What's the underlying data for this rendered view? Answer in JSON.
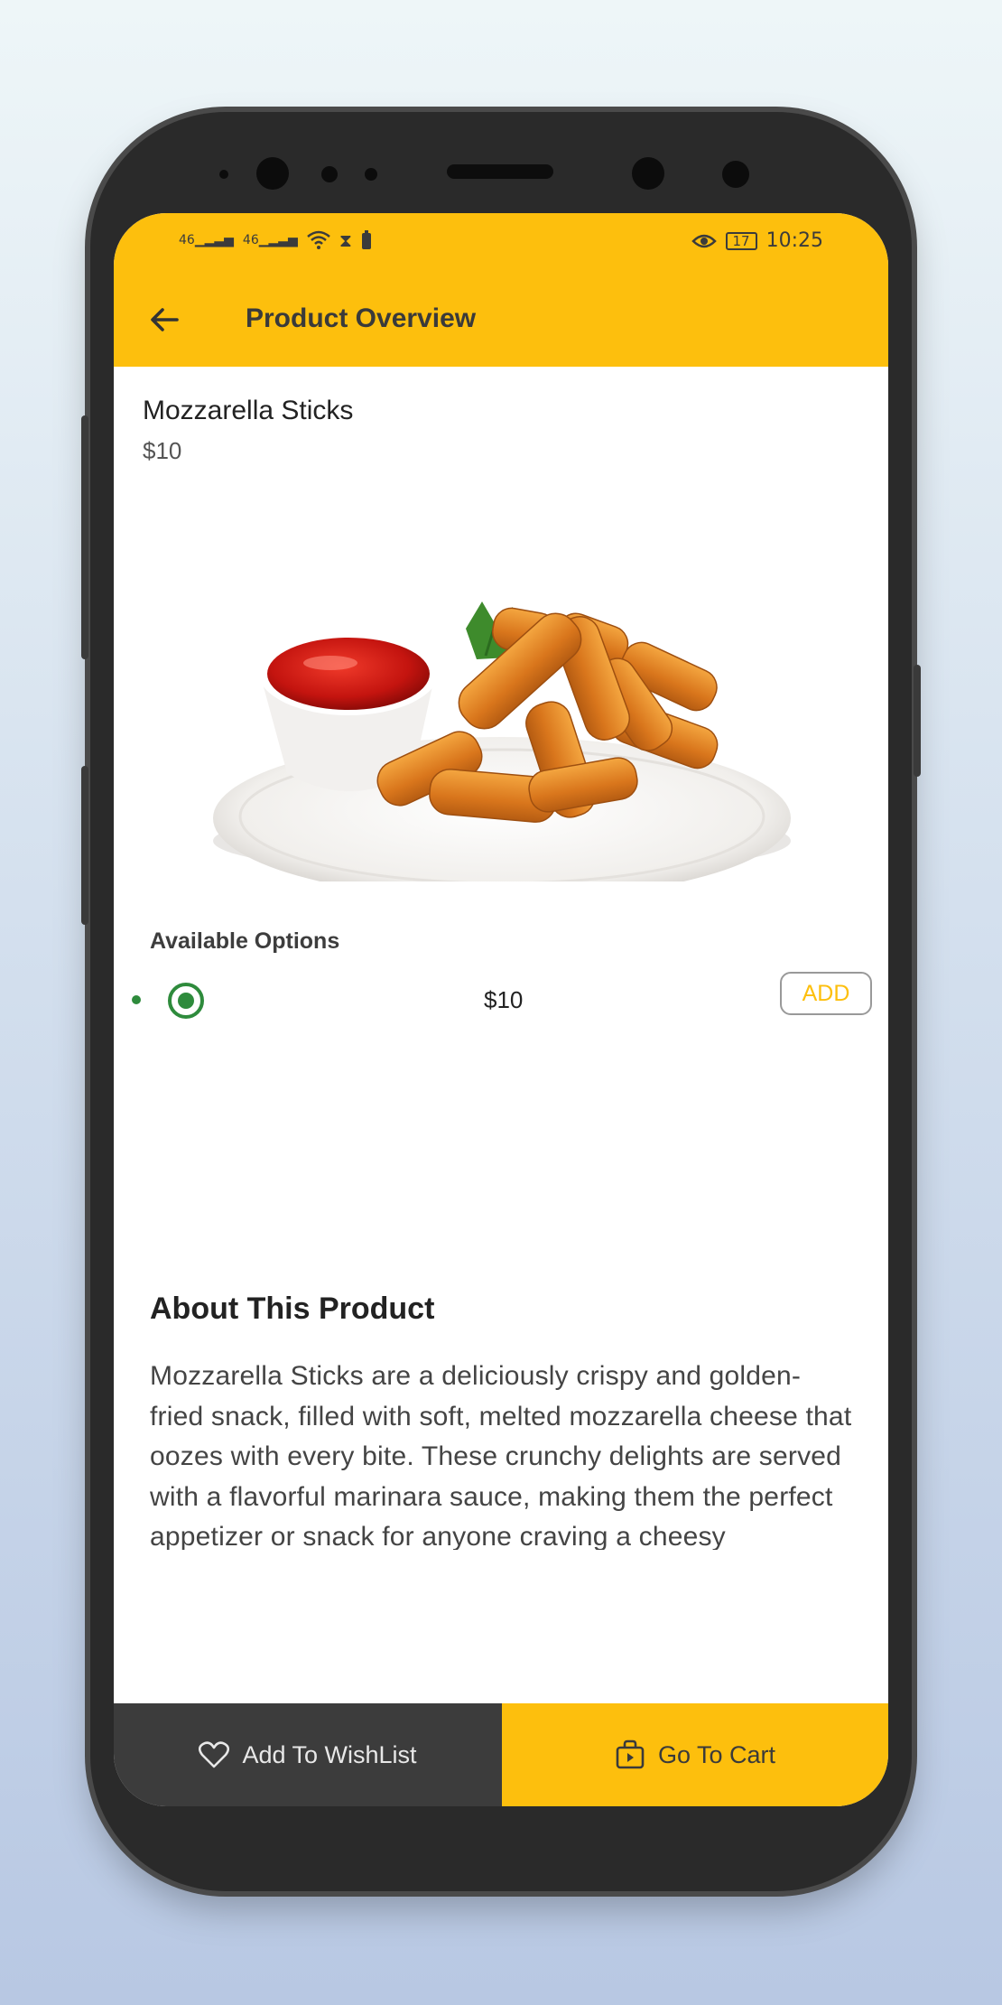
{
  "status_bar": {
    "signal_1": "46",
    "signal_2": "46",
    "battery": "17",
    "time": "10:25"
  },
  "appbar": {
    "title": "Product Overview"
  },
  "product": {
    "name": "Mozzarella Sticks",
    "price": "$10"
  },
  "options": {
    "title": "Available Options",
    "items": [
      {
        "price": "$10",
        "add_label": "ADD",
        "selected": true
      }
    ]
  },
  "about": {
    "title": "About This Product",
    "text": "Mozzarella Sticks are a deliciously crispy and golden-fried snack, filled with soft, melted mozzarella cheese that oozes with every bite. These crunchy delights are served with a flavorful marinara sauce, making them the perfect appetizer or snack for anyone craving a cheesy indulgence. Ideal for sharing or enjoying solo, they offer a satisfying combination of crunch and gooey"
  },
  "bottom_bar": {
    "wishlist_label": "Add To WishList",
    "cart_label": "Go To Cart"
  },
  "colors": {
    "accent": "#fdbf0d",
    "dark": "#3c3c3c",
    "radio_green": "#2e8b3c"
  },
  "icons": {
    "back": "arrow-left-icon",
    "wishlist": "heart-icon",
    "cart": "shopping-bag-icon",
    "radio": "radio-selected-icon"
  }
}
